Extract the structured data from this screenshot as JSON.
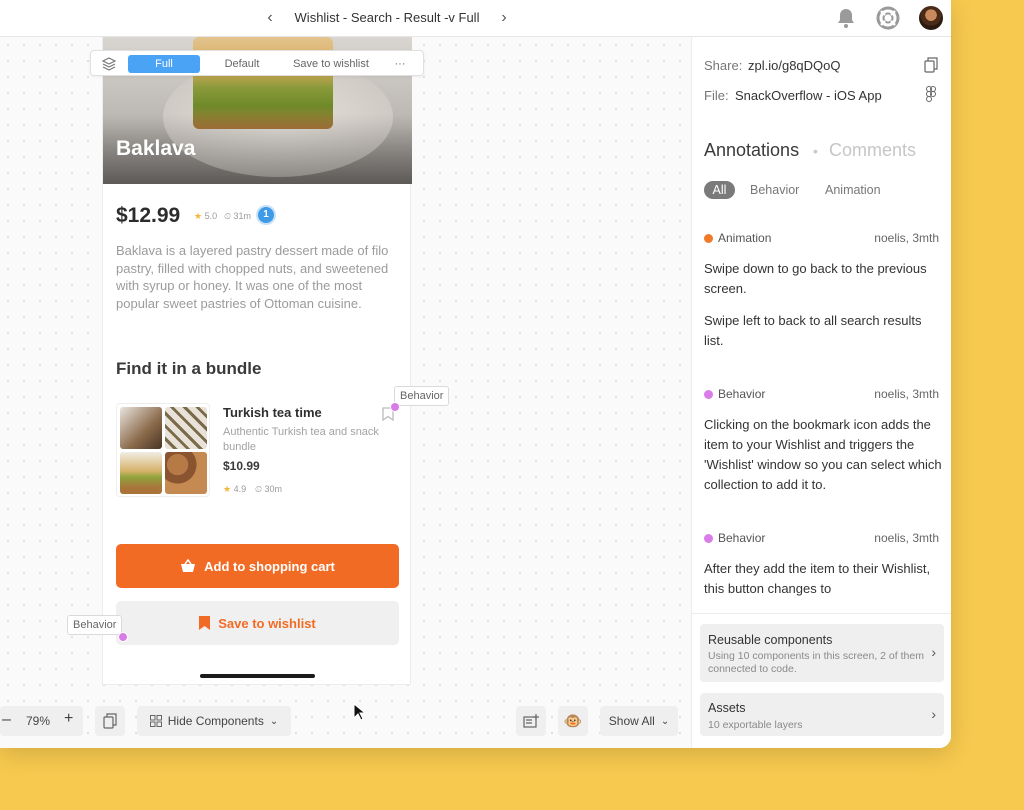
{
  "topbar": {
    "title": "Wishlist - Search - Result -v Full",
    "prev_icon": "chevron-left-icon",
    "next_icon": "chevron-right-icon"
  },
  "float_toolbar": {
    "tabs": [
      "Full",
      "Default",
      "Save to wishlist",
      "···"
    ],
    "active_tab": "Full"
  },
  "product": {
    "name": "Baklava",
    "price": "$12.99",
    "rating": "5.0",
    "time": "31m",
    "annotation_count": "1",
    "description": "Baklava is a layered pastry dessert made of filo pastry, filled with chopped nuts, and sweetened with syrup or honey. It was one of the most popular sweet pastries of Ottoman cuisine.",
    "bundle_heading": "Find it in a bundle",
    "bundle": {
      "title": "Turkish tea time",
      "subtitle": "Authentic Turkish tea and snack bundle",
      "price": "$10.99",
      "rating": "4.9",
      "time": "30m"
    },
    "add_to_cart_label": "Add to shopping cart",
    "save_wishlist_label": "Save to wishlist"
  },
  "canvas_tags": {
    "behavior_1": "Behavior",
    "behavior_2": "Behavior"
  },
  "bottom_bar": {
    "zoom": "79%",
    "hide_components": "Hide Components",
    "show_all": "Show All"
  },
  "panel": {
    "share_label": "Share:",
    "share_value": "zpl.io/g8qDQoQ",
    "file_label": "File:",
    "file_value": "SnackOverflow - iOS App",
    "annotations_heading": "Annotations",
    "comments_heading": "Comments",
    "filters": [
      "All",
      "Behavior",
      "Animation"
    ],
    "annotations": [
      {
        "type": "Animation",
        "color": "#f07a2a",
        "author": "noelis, 3mth",
        "text_1": "Swipe down to go back to the previous screen.",
        "text_2": "Swipe left to back to all search results list."
      },
      {
        "type": "Behavior",
        "color": "#d97be8",
        "author": "noelis, 3mth",
        "text_1": "Clicking on the bookmark icon adds the item to your Wishlist and triggers the 'Wishlist' window so you can select which collection to add it to."
      },
      {
        "type": "Behavior",
        "color": "#d97be8",
        "author": "noelis, 3mth",
        "text_1": "After they add the item to their Wishlist, this button changes to"
      }
    ],
    "reusable": {
      "title": "Reusable components",
      "subtitle": "Using 10 components in this screen, 2 of them connected to code."
    },
    "assets": {
      "title": "Assets",
      "subtitle": "10 exportable layers"
    }
  },
  "colors": {
    "accent_orange": "#f26b25",
    "tab_blue": "#4aa3f5",
    "background_yellow": "#f7c94e"
  }
}
